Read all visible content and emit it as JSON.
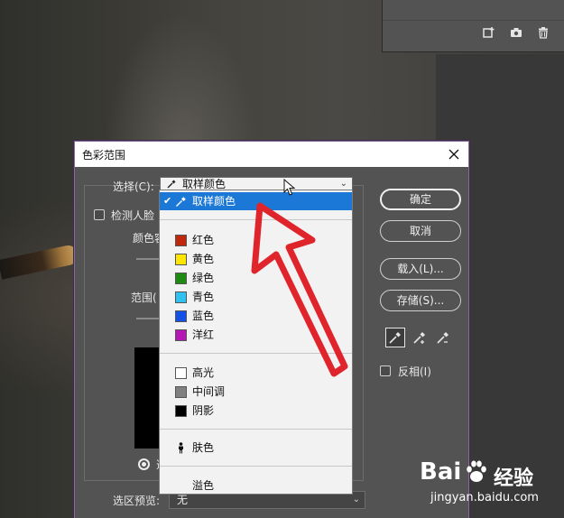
{
  "dialog": {
    "title": "色彩范围",
    "select_label": "选择(C):",
    "select_value": "取样颜色",
    "detect_faces_label": "检测人脸",
    "fuzziness_label": "颜色容",
    "range_label": "范围(",
    "radio_label": "选",
    "selection_preview_label": "选区预览:",
    "selection_preview_value": "无",
    "invert_label": "反相(I)",
    "buttons": {
      "ok": "确定",
      "cancel": "取消",
      "load": "载入(L)...",
      "save": "存储(S)..."
    }
  },
  "dropdown": {
    "items": [
      {
        "label": "取样颜色",
        "icon": "eyedropper-icon",
        "selected": true
      },
      {
        "label": "红色",
        "swatch": "#c0280e"
      },
      {
        "label": "黄色",
        "swatch": "#ffe600"
      },
      {
        "label": "绿色",
        "swatch": "#1d8a12"
      },
      {
        "label": "青色",
        "swatch": "#2fc2f0"
      },
      {
        "label": "蓝色",
        "swatch": "#1450e6"
      },
      {
        "label": "洋红",
        "swatch": "#b417b4"
      },
      {
        "label": "高光",
        "swatch": "#ffffff"
      },
      {
        "label": "中间调",
        "swatch": "#808080"
      },
      {
        "label": "阴影",
        "swatch": "#000000"
      },
      {
        "label": "肤色",
        "icon": "person-icon"
      },
      {
        "label": "溢色"
      }
    ]
  },
  "watermark": {
    "brand": "Bai",
    "brand_cn": "经验",
    "url": "jingyan.baidu.com"
  },
  "colors": {
    "accent": "#1c78d6",
    "dialog_bg": "#535353",
    "annotation_arrow": "#e0242c"
  }
}
